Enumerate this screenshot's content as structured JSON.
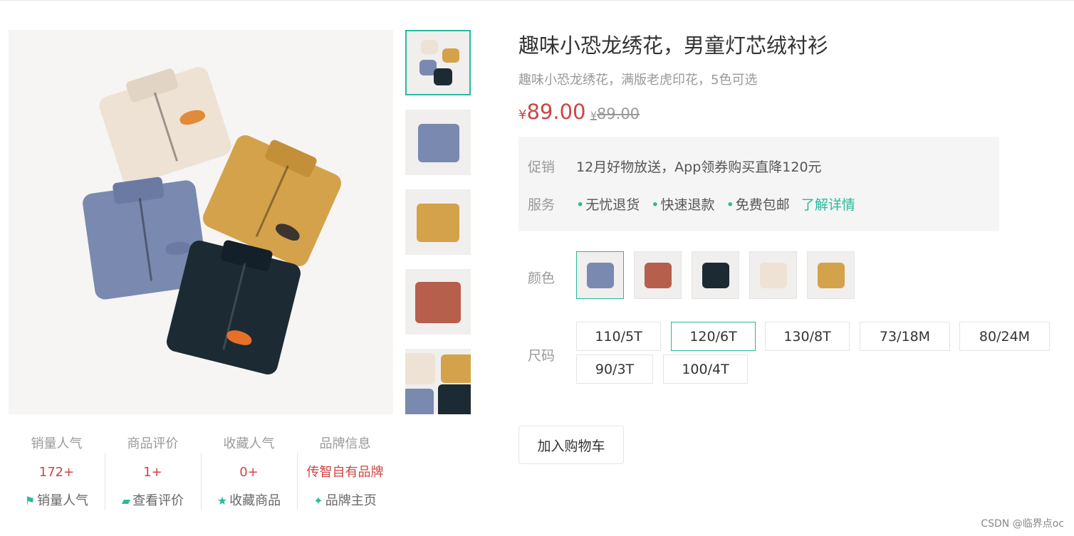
{
  "product": {
    "title": "趣味小恐龙绣花，男童灯芯绒衬衫",
    "subtitle": "趣味小恐龙绣花，满版老虎印花，5色可选",
    "currency": "¥",
    "price": "89.00",
    "old_price": "89.00"
  },
  "promo": {
    "label": "促销",
    "text": "12月好物放送，App领券购买直降120元"
  },
  "service": {
    "label": "服务",
    "items": [
      "无忧退货",
      "快速退款",
      "免费包邮"
    ],
    "link": "了解详情"
  },
  "color": {
    "label": "颜色",
    "options": [
      {
        "name": "blue-gray",
        "hex": "#7a89b0"
      },
      {
        "name": "brick-print",
        "hex": "#b65f4c"
      },
      {
        "name": "navy",
        "hex": "#1c2a33"
      },
      {
        "name": "cream",
        "hex": "#eee2d5"
      },
      {
        "name": "mustard",
        "hex": "#d4a24a"
      }
    ],
    "selected": 0
  },
  "size": {
    "label": "尺码",
    "options": [
      "110/5T",
      "120/6T",
      "130/8T",
      "73/18M",
      "80/24M",
      "90/3T",
      "100/4T"
    ],
    "selected": 1
  },
  "cart_button": "加入购物车",
  "stats": [
    {
      "title": "销量人气",
      "value": "172+",
      "link": "销量人气",
      "icon": "flag-icon"
    },
    {
      "title": "商品评价",
      "value": "1+",
      "link": "查看评价",
      "icon": "comment-icon"
    },
    {
      "title": "收藏人气",
      "value": "0+",
      "link": "收藏商品",
      "icon": "star-icon"
    },
    {
      "title": "品牌信息",
      "value": "传智自有品牌",
      "link": "品牌主页",
      "icon": "brand-icon"
    }
  ],
  "colors": {
    "accent": "#27ba9b",
    "price": "#cf4444"
  },
  "watermark": "CSDN @临界点oc"
}
